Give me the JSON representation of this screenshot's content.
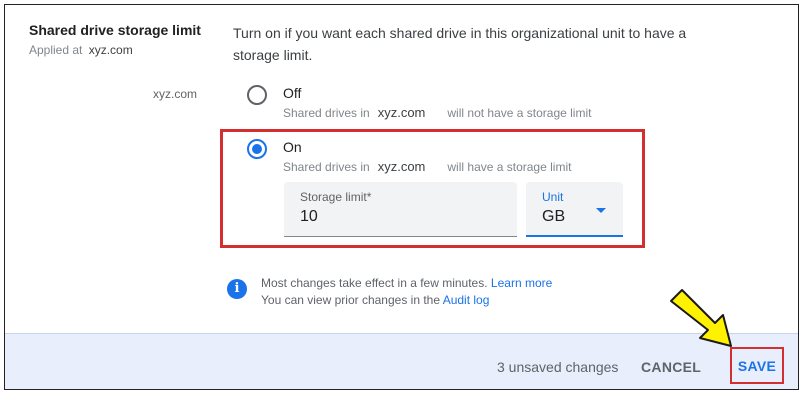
{
  "setting": {
    "title": "Shared drive storage limit",
    "applied_at_label": "Applied at",
    "applied_at_domain": "xyz.com",
    "description": "Turn on if you want each shared drive in this organizational unit to have a storage limit."
  },
  "org_unit_label": "xyz.com",
  "options": {
    "off": {
      "label": "Off",
      "desc_prefix": "Shared drives in",
      "desc_domain": "xyz.com",
      "desc_suffix": "will not have a storage limit",
      "selected": false
    },
    "on": {
      "label": "On",
      "desc_prefix": "Shared drives in",
      "desc_domain": "xyz.com",
      "desc_suffix": "will have a storage limit",
      "selected": true
    }
  },
  "storage_limit": {
    "label": "Storage limit*",
    "value": "10"
  },
  "unit": {
    "label": "Unit",
    "value": "GB"
  },
  "info": {
    "line1_text": "Most changes take effect in a few minutes.",
    "line1_link": "Learn more",
    "line2_text": "You can view prior changes in the",
    "line2_link": "Audit log"
  },
  "footer": {
    "unsaved": "3 unsaved changes",
    "cancel": "CANCEL",
    "save": "SAVE"
  },
  "colors": {
    "accent": "#1a73e8",
    "highlight": "#d32f2f",
    "pointer_arrow": "#fff200",
    "footer_bg": "#e8eefb"
  },
  "icons": {
    "info": "info-icon",
    "dropdown": "chevron-down-icon",
    "pointer": "pointer-arrow-icon"
  }
}
